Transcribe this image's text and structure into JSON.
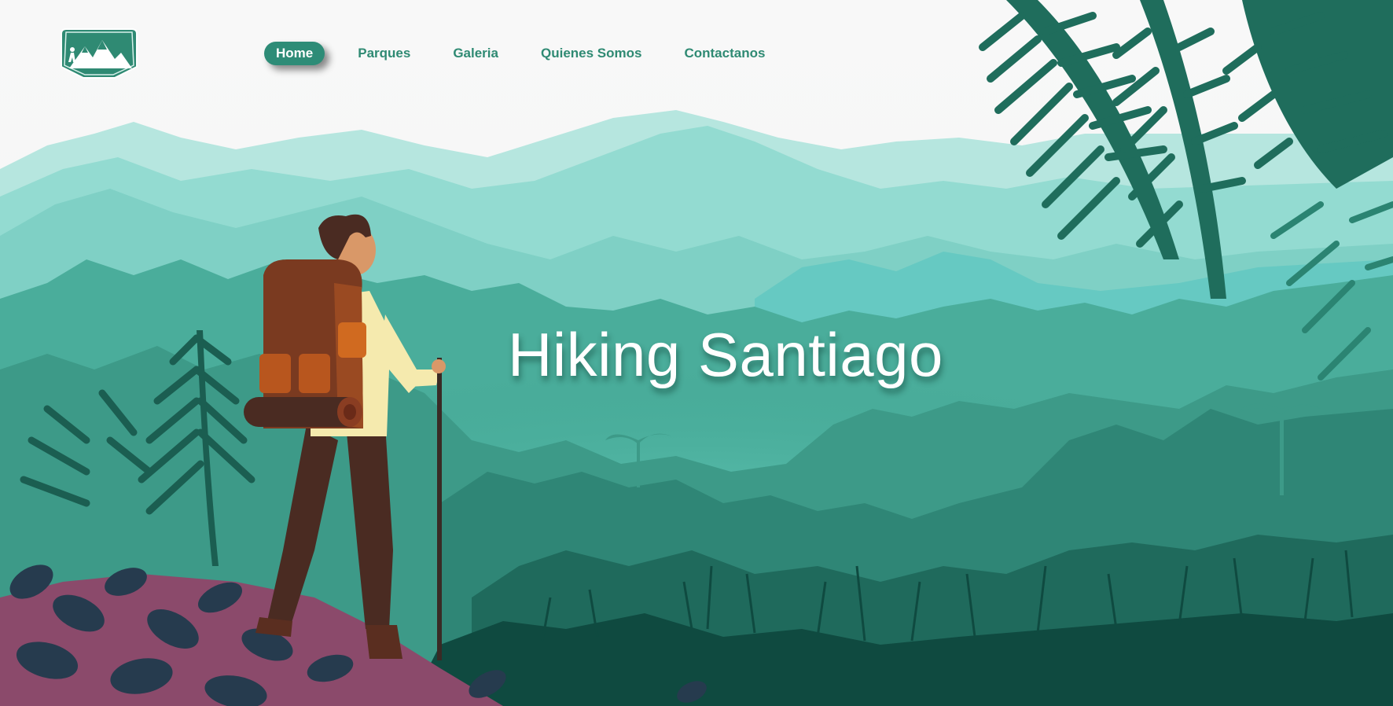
{
  "brand": {
    "logo_icon": "mountain-hiker-logo-icon",
    "color_primary": "#2e8c77"
  },
  "nav": {
    "items": [
      {
        "label": "Home",
        "active": true
      },
      {
        "label": "Parques",
        "active": false
      },
      {
        "label": "Galeria",
        "active": false
      },
      {
        "label": "Quienes Somos",
        "active": false
      },
      {
        "label": "Contactanos",
        "active": false
      }
    ]
  },
  "hero": {
    "title": "Hiking Santiago",
    "illustration_icon": "hiker-landscape-illustration"
  }
}
